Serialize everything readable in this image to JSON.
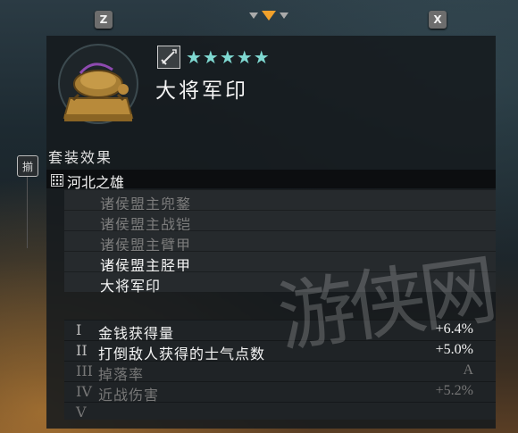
{
  "top_keys": {
    "left": "Z",
    "right": "X"
  },
  "item": {
    "name": "大将军印",
    "stars": "★★★★★",
    "icon": "turtle-seal-icon",
    "type_icon": "sword-icon"
  },
  "set": {
    "header": "套装效果",
    "side_badge": "揃",
    "name": "河北之雄",
    "pieces": [
      {
        "label": "诸侯盟主兜鍪",
        "owned": false
      },
      {
        "label": "诸侯盟主战铠",
        "owned": false
      },
      {
        "label": "诸侯盟主臂甲",
        "owned": false
      },
      {
        "label": "诸侯盟主胫甲",
        "owned": true
      },
      {
        "label": "大将军印",
        "owned": true
      }
    ]
  },
  "bonuses": [
    {
      "numeral": "I",
      "label": "金钱获得量",
      "value": "+6.4%",
      "active": true
    },
    {
      "numeral": "II",
      "label": "打倒敌人获得的士气点数",
      "value": "+5.0%",
      "active": true
    },
    {
      "numeral": "III",
      "label": "掉落率",
      "value": "A",
      "active": false
    },
    {
      "numeral": "IV",
      "label": "近战伤害",
      "value": "+5.2%",
      "active": false
    },
    {
      "numeral": "V",
      "label": "",
      "value": "",
      "active": false
    }
  ],
  "watermark": "游侠网",
  "colors": {
    "accent": "#f2a12b",
    "stars": "#7fd9d2"
  }
}
